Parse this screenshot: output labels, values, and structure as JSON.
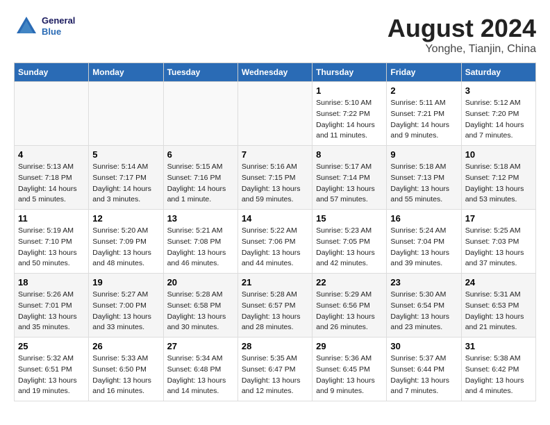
{
  "header": {
    "logo_line1": "General",
    "logo_line2": "Blue",
    "title": "August 2024",
    "subtitle": "Yonghe, Tianjin, China"
  },
  "columns": [
    "Sunday",
    "Monday",
    "Tuesday",
    "Wednesday",
    "Thursday",
    "Friday",
    "Saturday"
  ],
  "weeks": [
    [
      {
        "day": "",
        "detail": ""
      },
      {
        "day": "",
        "detail": ""
      },
      {
        "day": "",
        "detail": ""
      },
      {
        "day": "",
        "detail": ""
      },
      {
        "day": "1",
        "detail": "Sunrise: 5:10 AM\nSunset: 7:22 PM\nDaylight: 14 hours\nand 11 minutes."
      },
      {
        "day": "2",
        "detail": "Sunrise: 5:11 AM\nSunset: 7:21 PM\nDaylight: 14 hours\nand 9 minutes."
      },
      {
        "day": "3",
        "detail": "Sunrise: 5:12 AM\nSunset: 7:20 PM\nDaylight: 14 hours\nand 7 minutes."
      }
    ],
    [
      {
        "day": "4",
        "detail": "Sunrise: 5:13 AM\nSunset: 7:18 PM\nDaylight: 14 hours\nand 5 minutes."
      },
      {
        "day": "5",
        "detail": "Sunrise: 5:14 AM\nSunset: 7:17 PM\nDaylight: 14 hours\nand 3 minutes."
      },
      {
        "day": "6",
        "detail": "Sunrise: 5:15 AM\nSunset: 7:16 PM\nDaylight: 14 hours\nand 1 minute."
      },
      {
        "day": "7",
        "detail": "Sunrise: 5:16 AM\nSunset: 7:15 PM\nDaylight: 13 hours\nand 59 minutes."
      },
      {
        "day": "8",
        "detail": "Sunrise: 5:17 AM\nSunset: 7:14 PM\nDaylight: 13 hours\nand 57 minutes."
      },
      {
        "day": "9",
        "detail": "Sunrise: 5:18 AM\nSunset: 7:13 PM\nDaylight: 13 hours\nand 55 minutes."
      },
      {
        "day": "10",
        "detail": "Sunrise: 5:18 AM\nSunset: 7:12 PM\nDaylight: 13 hours\nand 53 minutes."
      }
    ],
    [
      {
        "day": "11",
        "detail": "Sunrise: 5:19 AM\nSunset: 7:10 PM\nDaylight: 13 hours\nand 50 minutes."
      },
      {
        "day": "12",
        "detail": "Sunrise: 5:20 AM\nSunset: 7:09 PM\nDaylight: 13 hours\nand 48 minutes."
      },
      {
        "day": "13",
        "detail": "Sunrise: 5:21 AM\nSunset: 7:08 PM\nDaylight: 13 hours\nand 46 minutes."
      },
      {
        "day": "14",
        "detail": "Sunrise: 5:22 AM\nSunset: 7:06 PM\nDaylight: 13 hours\nand 44 minutes."
      },
      {
        "day": "15",
        "detail": "Sunrise: 5:23 AM\nSunset: 7:05 PM\nDaylight: 13 hours\nand 42 minutes."
      },
      {
        "day": "16",
        "detail": "Sunrise: 5:24 AM\nSunset: 7:04 PM\nDaylight: 13 hours\nand 39 minutes."
      },
      {
        "day": "17",
        "detail": "Sunrise: 5:25 AM\nSunset: 7:03 PM\nDaylight: 13 hours\nand 37 minutes."
      }
    ],
    [
      {
        "day": "18",
        "detail": "Sunrise: 5:26 AM\nSunset: 7:01 PM\nDaylight: 13 hours\nand 35 minutes."
      },
      {
        "day": "19",
        "detail": "Sunrise: 5:27 AM\nSunset: 7:00 PM\nDaylight: 13 hours\nand 33 minutes."
      },
      {
        "day": "20",
        "detail": "Sunrise: 5:28 AM\nSunset: 6:58 PM\nDaylight: 13 hours\nand 30 minutes."
      },
      {
        "day": "21",
        "detail": "Sunrise: 5:28 AM\nSunset: 6:57 PM\nDaylight: 13 hours\nand 28 minutes."
      },
      {
        "day": "22",
        "detail": "Sunrise: 5:29 AM\nSunset: 6:56 PM\nDaylight: 13 hours\nand 26 minutes."
      },
      {
        "day": "23",
        "detail": "Sunrise: 5:30 AM\nSunset: 6:54 PM\nDaylight: 13 hours\nand 23 minutes."
      },
      {
        "day": "24",
        "detail": "Sunrise: 5:31 AM\nSunset: 6:53 PM\nDaylight: 13 hours\nand 21 minutes."
      }
    ],
    [
      {
        "day": "25",
        "detail": "Sunrise: 5:32 AM\nSunset: 6:51 PM\nDaylight: 13 hours\nand 19 minutes."
      },
      {
        "day": "26",
        "detail": "Sunrise: 5:33 AM\nSunset: 6:50 PM\nDaylight: 13 hours\nand 16 minutes."
      },
      {
        "day": "27",
        "detail": "Sunrise: 5:34 AM\nSunset: 6:48 PM\nDaylight: 13 hours\nand 14 minutes."
      },
      {
        "day": "28",
        "detail": "Sunrise: 5:35 AM\nSunset: 6:47 PM\nDaylight: 13 hours\nand 12 minutes."
      },
      {
        "day": "29",
        "detail": "Sunrise: 5:36 AM\nSunset: 6:45 PM\nDaylight: 13 hours\nand 9 minutes."
      },
      {
        "day": "30",
        "detail": "Sunrise: 5:37 AM\nSunset: 6:44 PM\nDaylight: 13 hours\nand 7 minutes."
      },
      {
        "day": "31",
        "detail": "Sunrise: 5:38 AM\nSunset: 6:42 PM\nDaylight: 13 hours\nand 4 minutes."
      }
    ]
  ]
}
